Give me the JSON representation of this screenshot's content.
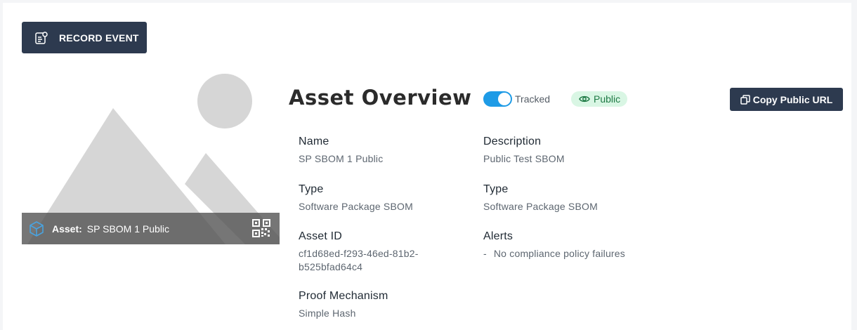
{
  "toolbar": {
    "record_event_label": "RECORD EVENT",
    "record_event_icon": "record-event-icon"
  },
  "asset_card": {
    "prefix": "Asset:",
    "name": "SP SBOM 1 Public",
    "icon": "cube-icon",
    "qr_icon": "qr-code-icon"
  },
  "header": {
    "title": "Asset Overview",
    "tracked_label": "Tracked",
    "tracked_on": true,
    "public_label": "Public",
    "copy_url_label": "Copy Public URL"
  },
  "fields_left": [
    {
      "label": "Name",
      "value": "SP SBOM 1 Public"
    },
    {
      "label": "Type",
      "value": "Software Package SBOM"
    },
    {
      "label": "Asset ID",
      "value_line1": "cf1d68ed-f293-46ed-81b2-",
      "value_line2": "b525bfad64c4"
    },
    {
      "label": "Proof Mechanism",
      "value": "Simple Hash"
    }
  ],
  "fields_right": [
    {
      "label": "Description",
      "value": "Public Test SBOM"
    },
    {
      "label": "Type",
      "value": "Software Package SBOM"
    },
    {
      "label": "Alerts",
      "dash": "-",
      "value": "No compliance policy failures"
    }
  ],
  "colors": {
    "primary_button": "#2d3a4f",
    "toggle_on": "#1e9be6",
    "public_badge_bg": "#d9f6e4",
    "public_badge_text": "#1f7a45",
    "cube_icon": "#4aa3df"
  }
}
